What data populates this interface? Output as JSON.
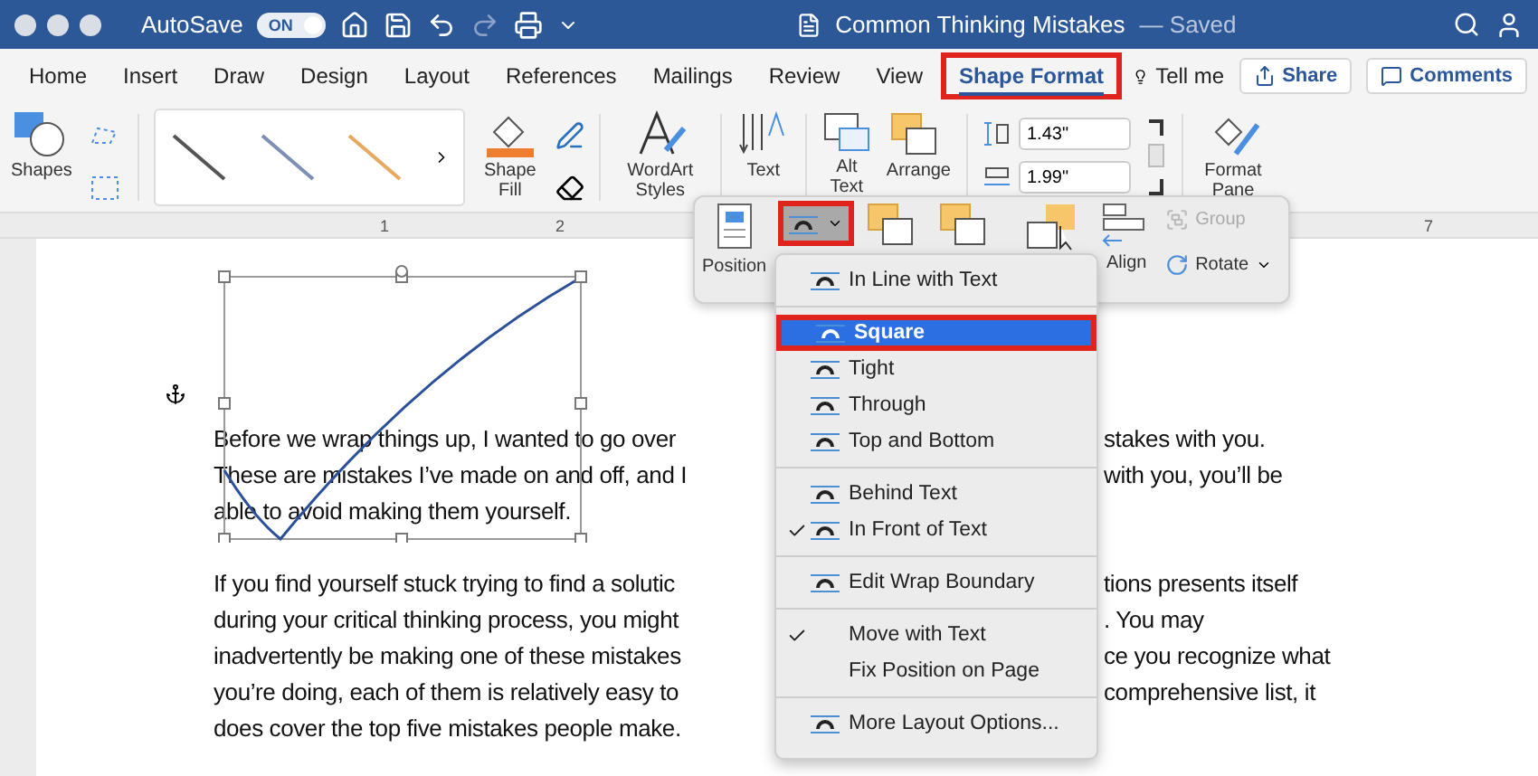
{
  "window": {
    "title": "Common Thinking Mistakes",
    "status": "— Saved",
    "autosave_label": "AutoSave",
    "autosave_toggle": "ON",
    "autosave_on": true
  },
  "tabs": [
    {
      "label": "Home",
      "selected": false,
      "annotated": false
    },
    {
      "label": "Insert",
      "selected": false,
      "annotated": false
    },
    {
      "label": "Draw",
      "selected": false,
      "annotated": false
    },
    {
      "label": "Design",
      "selected": false,
      "annotated": false
    },
    {
      "label": "Layout",
      "selected": false,
      "annotated": false
    },
    {
      "label": "References",
      "selected": false,
      "annotated": false
    },
    {
      "label": "Mailings",
      "selected": false,
      "annotated": false
    },
    {
      "label": "Review",
      "selected": false,
      "annotated": false
    },
    {
      "label": "View",
      "selected": false,
      "annotated": false
    },
    {
      "label": "Shape Format",
      "selected": true,
      "annotated": true
    }
  ],
  "tell_me": "Tell me",
  "share": "Share",
  "comments": "Comments",
  "ribbon": {
    "shapes": "Shapes",
    "shape_fill": "Shape Fill",
    "wordart": "WordArt Styles",
    "text": "Text",
    "alt_text": "Alt Text",
    "arrange": "Arrange",
    "height": "1.43\"",
    "width": "1.99\"",
    "format_pane": "Format Pane"
  },
  "ruler": [
    {
      "label": "1"
    },
    {
      "label": "2"
    },
    {
      "label": "7"
    }
  ],
  "arrange_panel": {
    "position": "Position",
    "wrap_pressed": true,
    "wrap_annotated": true,
    "align": "Align",
    "group": "Group",
    "group_disabled": true,
    "rotate": "Rotate"
  },
  "wrap_menu": [
    {
      "kind": "wrap",
      "label": "In Line with Text",
      "selected": false,
      "checked": false,
      "annotated": false
    },
    {
      "kind": "separator"
    },
    {
      "kind": "wrap",
      "label": "Square",
      "selected": true,
      "checked": false,
      "annotated": true
    },
    {
      "kind": "wrap",
      "label": "Tight",
      "selected": false,
      "checked": false,
      "annotated": false
    },
    {
      "kind": "wrap",
      "label": "Through",
      "selected": false,
      "checked": false,
      "annotated": false
    },
    {
      "kind": "wrap",
      "label": "Top and Bottom",
      "selected": false,
      "checked": false,
      "annotated": false
    },
    {
      "kind": "separator"
    },
    {
      "kind": "wrap",
      "label": "Behind Text",
      "selected": false,
      "checked": false,
      "annotated": false
    },
    {
      "kind": "wrap",
      "label": "In Front of Text",
      "selected": false,
      "checked": true,
      "annotated": false
    },
    {
      "kind": "separator"
    },
    {
      "kind": "wrap",
      "label": "Edit Wrap Boundary",
      "selected": false,
      "checked": false,
      "annotated": false
    },
    {
      "kind": "separator"
    },
    {
      "kind": "plain",
      "label": "Move with Text",
      "selected": false,
      "checked": true,
      "annotated": false
    },
    {
      "kind": "plain",
      "label": "Fix Position on Page",
      "selected": false,
      "checked": false,
      "annotated": false
    },
    {
      "kind": "separator"
    },
    {
      "kind": "wrap",
      "label": "More Layout Options...",
      "selected": false,
      "checked": false,
      "annotated": false
    }
  ],
  "document": {
    "paragraphs": [
      [
        {
          "left": "Before we wrap things up, I wanted to go over",
          "right": "stakes with you."
        },
        {
          "left": "These are mistakes I’ve made on and off, and I",
          "right": "with you, you’ll be"
        },
        {
          "left": "able to avoid making them yourself."
        }
      ],
      [
        {
          "left": "If you find yourself stuck trying to find a solutic",
          "right": "tions presents itself"
        },
        {
          "left": "during your critical thinking process, you might",
          "right": ". You may"
        },
        {
          "left": "inadvertently be making one of these mistakes",
          "right": "ce you recognize what"
        },
        {
          "left": "you’re doing, each of them is relatively easy to",
          "right": "comprehensive list, it"
        },
        {
          "left": "does cover the top five mistakes people make."
        }
      ]
    ]
  }
}
